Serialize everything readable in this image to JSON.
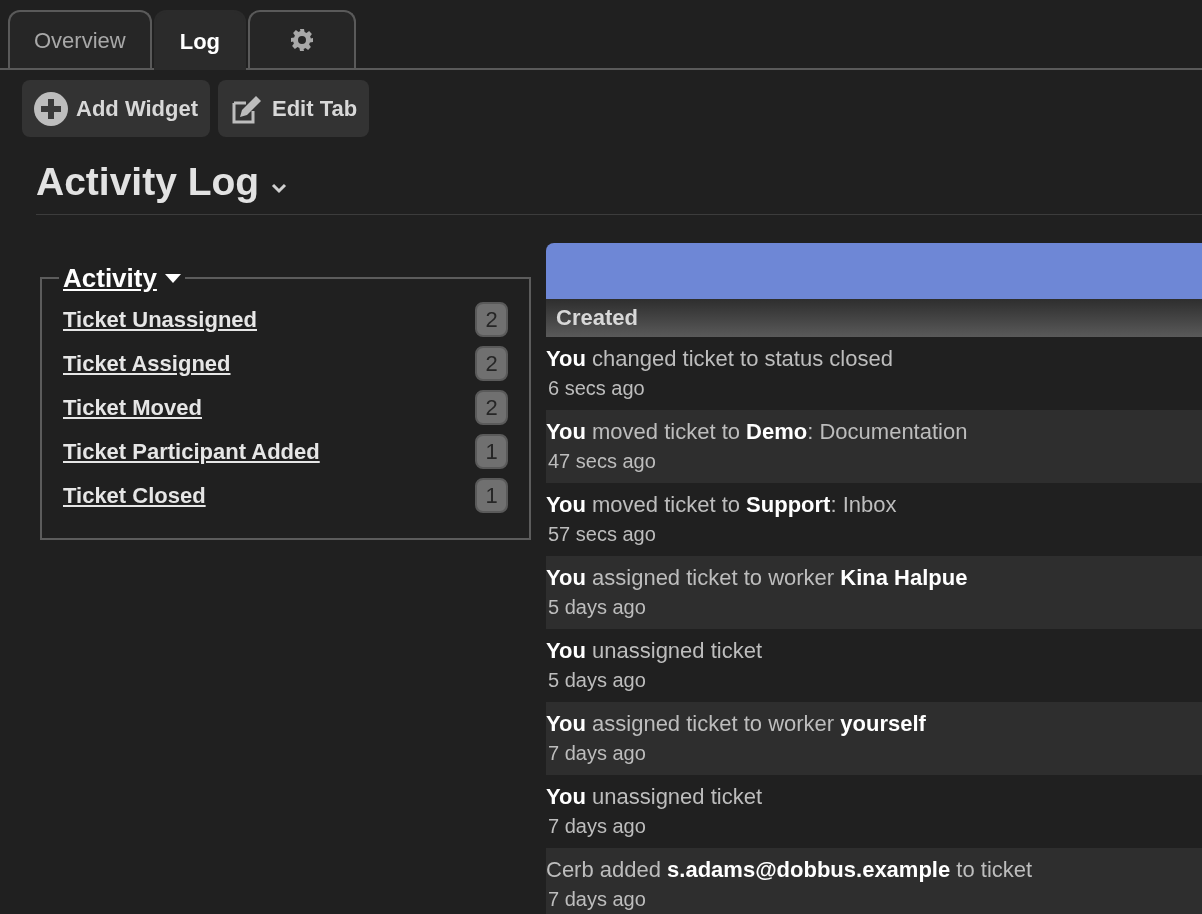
{
  "tabs": [
    {
      "kind": "text",
      "label": "Overview",
      "selected": false
    },
    {
      "kind": "text",
      "label": "Log",
      "selected": true
    },
    {
      "kind": "settings",
      "selected": false
    }
  ],
  "toolbar": [
    {
      "kind": "add",
      "label": "Add Widget"
    },
    {
      "kind": "edit",
      "label": "Edit Tab"
    }
  ],
  "page_title": "Activity Log",
  "activity_widget": {
    "title": "Activity",
    "items": [
      {
        "label": "Ticket Unassigned",
        "count": "2"
      },
      {
        "label": "Ticket Assigned",
        "count": "2"
      },
      {
        "label": "Ticket Moved",
        "count": "2"
      },
      {
        "label": "Ticket Participant Added",
        "count": "1"
      },
      {
        "label": "Ticket Closed",
        "count": "1"
      }
    ]
  },
  "log_table": {
    "column": "Created",
    "rows": [
      {
        "text": "**You** changed ticket to status closed",
        "time": "6 secs ago"
      },
      {
        "text": "**You** moved ticket to **Demo**: Documentation",
        "time": "47 secs ago"
      },
      {
        "text": "**You** moved ticket to **Support**: Inbox",
        "time": "57 secs ago"
      },
      {
        "text": "**You** assigned ticket to worker **Kina Halpue**",
        "time": "5 days ago"
      },
      {
        "text": "**You** unassigned ticket",
        "time": "5 days ago"
      },
      {
        "text": "**You** assigned ticket to worker **yourself**",
        "time": "7 days ago"
      },
      {
        "text": "**You** unassigned ticket",
        "time": "7 days ago"
      },
      {
        "text": "Cerb added **s.adams@dobbus.example** to ticket",
        "time": "7 days ago"
      }
    ]
  }
}
